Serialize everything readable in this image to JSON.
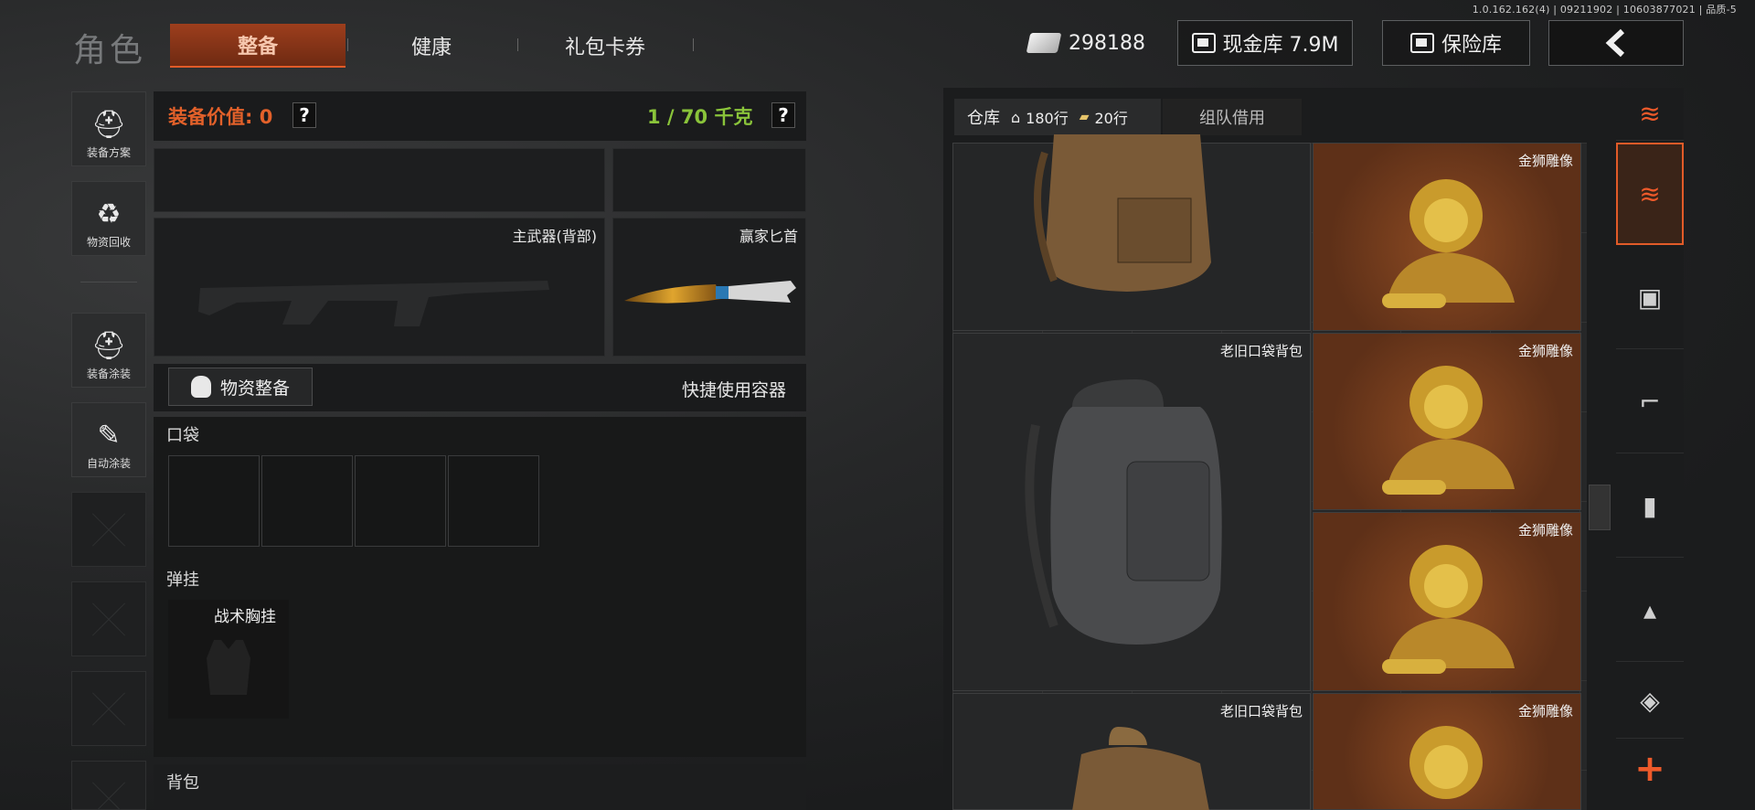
{
  "version": "1.0.162.162(4) | 09211902 | 10603877021 | 品质-5",
  "header": {
    "title": "角色",
    "tabs": [
      {
        "label": "整备",
        "active": true
      },
      {
        "label": "健康"
      },
      {
        "label": "礼包卡券"
      }
    ],
    "money": "298188",
    "cash_store": "现金库 7.9M",
    "safe_store": "保险库",
    "back_icon": "back-arrow-icon"
  },
  "side_menu": [
    {
      "label": "装备方案",
      "icon": "helmet-grid-icon"
    },
    {
      "label": "物资回收",
      "icon": "recycle-face-icon"
    },
    {
      "label": "装备涂装",
      "icon": "helmet-paint-icon"
    },
    {
      "label": "自动涂装",
      "icon": "brush-gear-icon"
    }
  ],
  "equipment": {
    "value_label": "装备价值: 0",
    "weight_label": "1 / 70 千克",
    "help": "?",
    "primary_weapon": "主武器(背部)",
    "knife": "赢家匕首",
    "supply_button": "物资整备",
    "quick_container": "快捷使用容器",
    "pockets_label": "口袋",
    "rig_label": "弹挂",
    "rig_name": "战术胸挂",
    "backpack_label": "背包"
  },
  "warehouse": {
    "tab_warehouse": "仓库",
    "rows_home": "180行",
    "rows_ticket": "20行",
    "tab_team": "组队借用",
    "items": [
      {
        "name": "",
        "type": "backpack-brown"
      },
      {
        "name": "金狮雕像",
        "type": "gold-lion"
      },
      {
        "name": "老旧口袋背包",
        "type": "backpack-gray"
      },
      {
        "name": "金狮雕像",
        "type": "gold-lion"
      },
      {
        "name": "金狮雕像",
        "type": "gold-lion"
      },
      {
        "name": "老旧口袋背包",
        "type": "backpack-brown"
      },
      {
        "name": "金狮雕像",
        "type": "gold-lion"
      }
    ]
  },
  "categories": [
    "sort-layers-icon",
    "stack-layers-icon",
    "vest-icon",
    "rifle-icon",
    "magazine-icon",
    "ammo-icon",
    "scope-icon"
  ],
  "plus": "+",
  "colors": {
    "accent": "#e25b28",
    "value": "#e3612a",
    "weight": "#8ac43a",
    "gold_bg": "#6a361b"
  }
}
